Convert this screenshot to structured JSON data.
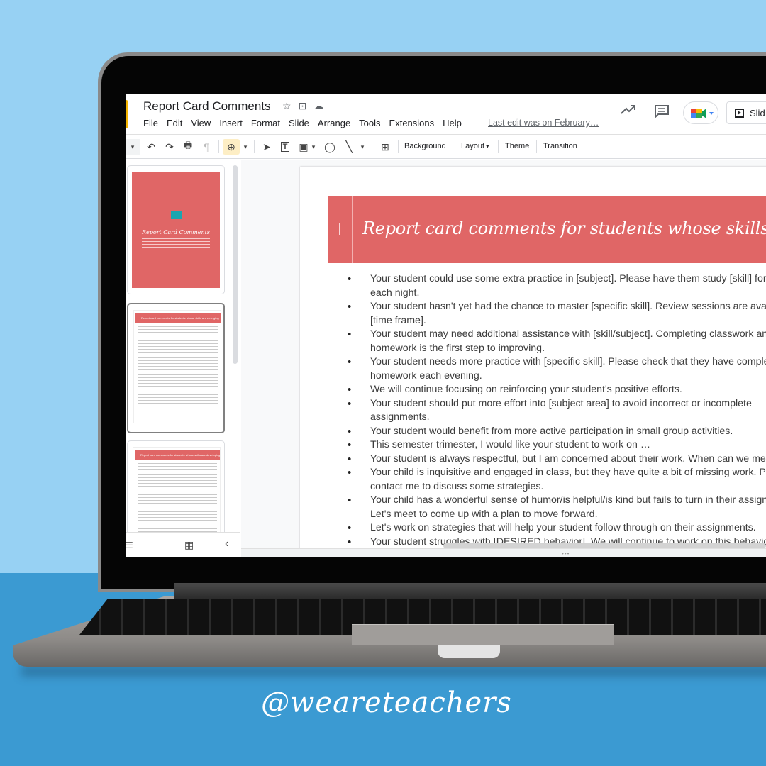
{
  "document": {
    "title": "Report Card Comments",
    "last_edit": "Last edit was on February…"
  },
  "menu": [
    "File",
    "Edit",
    "View",
    "Insert",
    "Format",
    "Slide",
    "Arrange",
    "Tools",
    "Extensions",
    "Help"
  ],
  "header_actions": {
    "activity_icon": "trending-up-icon",
    "comments_icon": "comment-icon",
    "meet_icon": "google-meet-icon",
    "slideshow_label": "Slid"
  },
  "toolbar": {
    "background_label": "Background",
    "layout_label": "Layout",
    "theme_label": "Theme",
    "transition_label": "Transition"
  },
  "filmstrip": {
    "slides": [
      {
        "type": "cover",
        "title": "Report Card Comments"
      },
      {
        "type": "list",
        "title": "Report card comments for students whose skills are emerging",
        "selected": true
      },
      {
        "type": "list",
        "title": "Report card comments for students whose skills are developing"
      }
    ]
  },
  "slide": {
    "index_marker": "|",
    "title": "Report card comments for students whose skills are emerging",
    "bullets": [
      "Your student could use some extra practice in [subject]. Please have them study [skill] for [time] each night.",
      "Your student hasn't yet had the chance to master [specific skill]. Review sessions are available [time frame].",
      "Your student may need additional assistance with [skill/subject]. Completing classwork and homework is the first step to improving.",
      "Your student needs more practice with [specific skill]. Please check that they have completed their homework each evening.",
      "We will continue focusing on reinforcing your student's positive efforts.",
      "Your student should put more effort into [subject area] to avoid incorrect or incomplete assignments.",
      "Your student would benefit from more active participation in small group activities.",
      "This semester trimester, I would like your student to work on …",
      "Your student is always respectful, but I am concerned about their work. When can we meet?",
      "Your child is inquisitive and engaged in class, but they have quite a bit of missing work. Please contact me to discuss some strategies.",
      "Your child has a wonderful sense of humor/is helpful/is kind but fails to turn in their assignments. Let's meet to come up with a plan to move forward.",
      "Let's work on strategies that will help your student follow through on their assignments.",
      "Your student struggles with [DESIRED behavior]. We will continue to work on this behavior."
    ]
  },
  "branding": {
    "handle": "@weareteachers"
  },
  "colors": {
    "accent": "#e06666",
    "sky": "#97d1f3",
    "floor": "#3b9ad2",
    "zoom_highlight": "#fdeec5"
  }
}
